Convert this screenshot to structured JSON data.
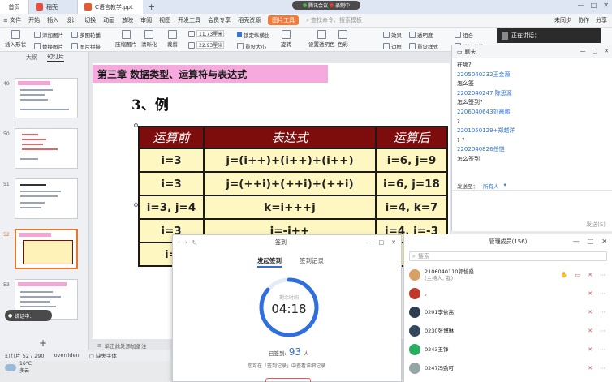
{
  "tabs": {
    "home": "首页",
    "docer": "稻壳",
    "file": "C语言教学.ppt",
    "plus": "+"
  },
  "meeting": {
    "label": "腾讯会议",
    "recording": "录制中"
  },
  "window_controls": {
    "min": "—",
    "max": "□",
    "close": "✕"
  },
  "menu": {
    "file": "≡ 文件",
    "items": [
      "开始",
      "插入",
      "设计",
      "切换",
      "动画",
      "放映",
      "审阅",
      "视图",
      "开发工具",
      "会员专享",
      "稻壳资源"
    ],
    "picture_tool": "图片工具",
    "search_placeholder": "查找命令、搜索模板",
    "right": [
      "未同步",
      "协作",
      "分享"
    ]
  },
  "ribbon": {
    "insert_shape": "插入形状",
    "add_picture": "添加图片",
    "multi_carousel": "多图轮播",
    "replace_picture": "替换图片",
    "picture_stitch": "图片拼接",
    "compress_picture": "压缩图片",
    "clarity": "清晰化",
    "crop": "裁剪",
    "height": "11.73厘米",
    "width": "22.93厘米",
    "lock_ratio": "锁定纵横比",
    "reset_size": "重设大小",
    "rotate": "旋转",
    "set_transparent": "设置透明色",
    "color": "色彩",
    "effect": "效果",
    "transparency": "透明度",
    "border": "边框",
    "reset_style": "重设样式",
    "group": "组合",
    "select_pane": "选择窗格"
  },
  "left_panel": {
    "tabs": [
      "大纲",
      "幻灯片"
    ],
    "active_tab": "幻灯片",
    "slide_numbers": [
      "49",
      "50",
      "51",
      "52",
      "53"
    ],
    "add": "+"
  },
  "slide": {
    "chapter_title": "第三章 数据类型、运算符与表达式",
    "example": "3、例",
    "table": {
      "headers": [
        "运算前",
        "表达式",
        "运算后"
      ],
      "rows": [
        [
          "i=3",
          "j=(i++)+(i++)+(i++)",
          "i=6, j=9"
        ],
        [
          "i=3",
          "j=(++i)+(++i)+(++i)",
          "i=6, j=18"
        ],
        [
          "i=3, j=4",
          "k=i+++j",
          "i=4, k=7"
        ],
        [
          "i=3",
          "j=-i++",
          "i=4, j=-3"
        ],
        [
          "i=",
          "",
          ""
        ]
      ]
    }
  },
  "notes_placeholder": "单击此处添加备注",
  "status": {
    "slide_counter": "幻灯片 52 / 290",
    "theme": "overriden",
    "missing_font": "缺失字体"
  },
  "weather": {
    "temp": "16°C",
    "desc": "多云"
  },
  "mic_float": "说话中：",
  "speaker": {
    "label": "正在讲话："
  },
  "chat": {
    "title": "聊天",
    "lines": [
      {
        "type": "msg",
        "text": "在哪?"
      },
      {
        "type": "user",
        "text": "2205040232王金源"
      },
      {
        "type": "msg",
        "text": "怎么签"
      },
      {
        "type": "user",
        "text": "2202040247   陈思源"
      },
      {
        "type": "msg",
        "text": "怎么签到?"
      },
      {
        "type": "user",
        "text": "2206040643刘晨鹏"
      },
      {
        "type": "msg",
        "text": "?"
      },
      {
        "type": "user",
        "text": "2201050129+郑越洋"
      },
      {
        "type": "msg",
        "text": "? ?"
      },
      {
        "type": "user",
        "text": "2202040826任恺"
      },
      {
        "type": "msg",
        "text": "怎么签到"
      }
    ],
    "send_to_label": "发送至：",
    "send_to_value": "所有人",
    "send_button": "发送(S)"
  },
  "signin": {
    "title": "签到",
    "tabs": [
      "发起签到",
      "签到记录"
    ],
    "active_tab": "发起签到",
    "remaining_label": "剩余时间",
    "time": "04:18",
    "signed_label": "已签到:",
    "signed_count": "93",
    "signed_unit": "人",
    "hint": "您可在「签到记录」中查看详细记录",
    "progress": 0.86
  },
  "members": {
    "title": "管理成员(156)",
    "search_placeholder": "搜索",
    "list": [
      {
        "name": "2106040110郭恰燊",
        "sub": "(主持人, 我)",
        "color": "#d9a066"
      },
      {
        "name": "。",
        "sub": "",
        "color": "#c0392b"
      },
      {
        "name": "0201李依高",
        "sub": "",
        "color": "#2c3e50"
      },
      {
        "name": "0230张博琳",
        "sub": "",
        "color": "#34495e"
      },
      {
        "name": "0243王铮",
        "sub": "",
        "color": "#27ae60"
      },
      {
        "name": "0247冯劲可",
        "sub": "",
        "color": "#95a5a6"
      }
    ]
  }
}
